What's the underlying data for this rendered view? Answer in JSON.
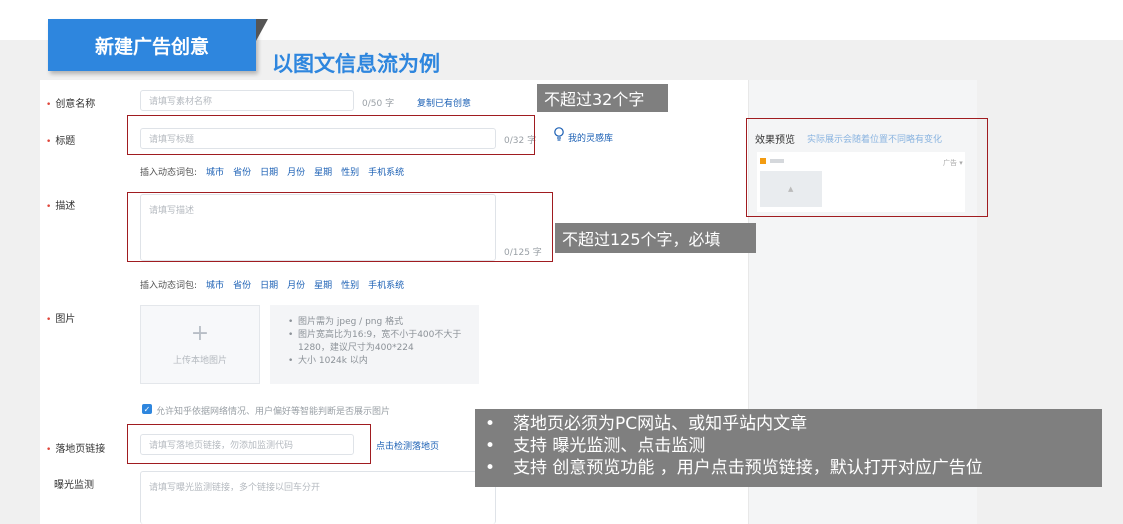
{
  "slide": {
    "tab_label": "新建广告创意",
    "subtitle": "以图文信息流为例"
  },
  "form": {
    "creative_name": {
      "label": "创意名称",
      "placeholder": "请填写素材名称",
      "counter": "0/50 字",
      "copy_link": "复制已有创意"
    },
    "title": {
      "label": "标题",
      "placeholder": "请填写标题",
      "counter": "0/32 字",
      "inspiration_link": "我的灵感库"
    },
    "dynamic_words_1": {
      "prefix": "插入动态词包:",
      "items": [
        "城市",
        "省份",
        "日期",
        "月份",
        "星期",
        "性别",
        "手机系统"
      ]
    },
    "description": {
      "label": "描述",
      "placeholder": "请填写描述",
      "counter": "0/125 字"
    },
    "dynamic_words_2": {
      "prefix": "插入动态词包:",
      "items": [
        "城市",
        "省份",
        "日期",
        "月份",
        "星期",
        "性别",
        "手机系统"
      ]
    },
    "image": {
      "label": "图片",
      "upload_text": "上传本地图片",
      "hints": [
        "图片需为 jpeg / png 格式",
        "图片宽高比为16:9，宽不小于400不大于1280，建议尺寸为400*224",
        "大小 1024k 以内"
      ],
      "checkbox_label": "允许知乎依据网络情况、用户偏好等智能判断是否展示图片"
    },
    "landing_page": {
      "label": "落地页链接",
      "placeholder": "请填写落地页链接，勿添加监测代码",
      "detect_link": "点击检测落地页"
    },
    "exposure_monitor": {
      "label": "曝光监测",
      "placeholder": "请填写曝光监测链接，多个链接以回车分开"
    }
  },
  "preview": {
    "title": "效果预览",
    "subtitle": "实际展示会随着位置不同略有变化",
    "tag": "广告 ▾"
  },
  "callouts": {
    "title_limit": "不超过32个字",
    "desc_limit": "不超过125个字，必填",
    "notes": [
      "落地页必须为PC网站、或知乎站内文章",
      "支持 曝光监测、点击监测",
      "支持 创意预览功能 ，用户点击预览链接，默认打开对应广告位"
    ]
  },
  "colors": {
    "accent": "#2e86de",
    "link": "#1a5fb4",
    "required": "#e0453a",
    "highlight_frame": "#a01c20",
    "callout_bg": "#7f7f7f"
  }
}
